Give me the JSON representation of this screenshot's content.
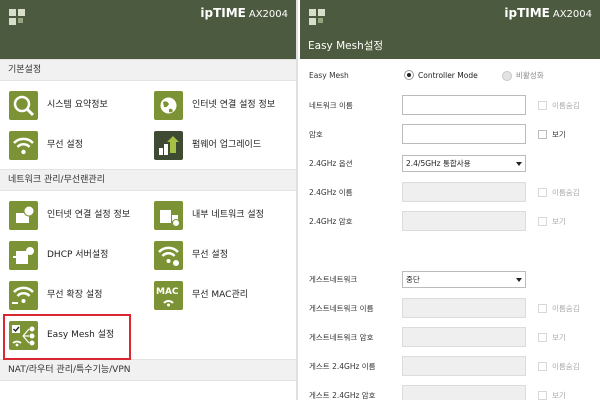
{
  "left": {
    "brand": "ipTIME",
    "model": "AX2004",
    "sections": [
      {
        "title": "기본설정",
        "items": [
          {
            "label": "시스템 요약정보",
            "icon": "magnifier-icon"
          },
          {
            "label": "인터넷 연결 설정 정보",
            "icon": "globe-icon"
          },
          {
            "label": "무선 설정",
            "icon": "wifi-icon"
          },
          {
            "label": "펌웨어 업그레이드",
            "icon": "upgrade-icon"
          }
        ]
      },
      {
        "title": "네트워크 관리/무선랜관리",
        "items": [
          {
            "label": "인터넷 연결 설정 정보",
            "icon": "router-globe-icon"
          },
          {
            "label": "내부 네트워크 설정",
            "icon": "network-icon"
          },
          {
            "label": "DHCP 서버설정",
            "icon": "dhcp-icon"
          },
          {
            "label": "무선 설정",
            "icon": "wifi-router-icon"
          },
          {
            "label": "무선 확장 설정",
            "icon": "wifi-extend-icon"
          },
          {
            "label": "무선 MAC관리",
            "icon": "mac-icon"
          },
          {
            "label": "Easy Mesh 설정",
            "icon": "mesh-icon"
          }
        ]
      },
      {
        "title": "NAT/라우터 관리/특수기능/VPN",
        "items": []
      }
    ]
  },
  "right": {
    "brand": "ipTIME",
    "model": "AX2004",
    "title": "Easy Mesh설정",
    "easy_mesh_label": "Easy Mesh",
    "radio_controller": "Controller Mode",
    "radio_disable": "비활성화",
    "rows": [
      {
        "label": "네트워크 이름",
        "type": "input",
        "check": "이름숨김",
        "check_disabled": true,
        "disabled": false
      },
      {
        "label": "암호",
        "type": "input",
        "check": "보기",
        "check_disabled": false,
        "disabled": false
      },
      {
        "label": "2.4GHz 옵션",
        "type": "select",
        "value": "2.4/5GHz 통합사용"
      },
      {
        "label": "2.4GHz 이름",
        "type": "input",
        "check": "이름숨김",
        "check_disabled": true,
        "disabled": true
      },
      {
        "label": "2.4GHz 암호",
        "type": "input",
        "check": "보기",
        "check_disabled": true,
        "disabled": true
      },
      {
        "label": "",
        "type": "gap"
      },
      {
        "label": "게스트네트워크",
        "type": "select",
        "value": "중단"
      },
      {
        "label": "게스트네트워크 이름",
        "type": "input",
        "check": "이름숨김",
        "check_disabled": true,
        "disabled": true
      },
      {
        "label": "게스트네트워크 암호",
        "type": "input",
        "check": "보기",
        "check_disabled": true,
        "disabled": true
      },
      {
        "label": "게스트 2.4GHz 이름",
        "type": "input",
        "check": "이름숨김",
        "check_disabled": true,
        "disabled": true
      },
      {
        "label": "게스트 2.4GHz 암호",
        "type": "input",
        "check": "보기",
        "check_disabled": true,
        "disabled": true
      }
    ]
  },
  "colors": {
    "header": "#4c5b3f",
    "icon": "#7b9334",
    "highlight": "#d9282f"
  }
}
